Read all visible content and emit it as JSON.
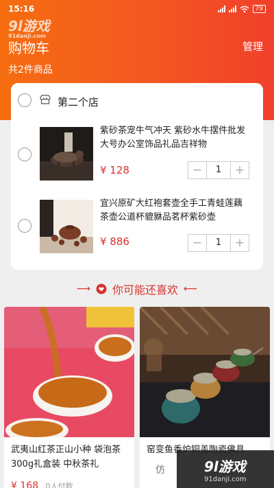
{
  "status_bar": {
    "time": "15:16",
    "battery": "79"
  },
  "watermark": {
    "brand": "9l游戏",
    "site": "91danji.com",
    "brand_bottom": "9l游戏",
    "site_bottom": "91danji.com",
    "left_tag": "仿"
  },
  "header": {
    "title": "购物车",
    "manage_label": "管理",
    "item_count": "共2件商品"
  },
  "store": {
    "name": "第二个店"
  },
  "cart_items": [
    {
      "name": "紫砂茶宠牛气冲天 紫砂水牛摆件批发大号办公室饰品礼品吉祥物",
      "price": "¥ 128",
      "quantity": "1"
    },
    {
      "name": "宜兴原矿大红袍套壶全手工青蛙莲藕茶壶公道杯貔貅品茗杯紫砂壶",
      "price": "¥ 886",
      "quantity": "1"
    }
  ],
  "stepper": {
    "minus": "−",
    "plus": "+"
  },
  "recommend": {
    "title": "你可能还喜欢",
    "items": [
      {
        "name": "武夷山红茶正山小种 袋泡茶300g礼盒装 中秋茶礼",
        "price": "¥ 168",
        "sold": "0人付款"
      },
      {
        "name": "窑变鱼香炉铜盖陶瓷佛具",
        "price": "",
        "sold": ""
      }
    ]
  },
  "colors": {
    "accent": "#d8332c",
    "header_start": "#f56d10",
    "header_end": "#f1402a"
  }
}
